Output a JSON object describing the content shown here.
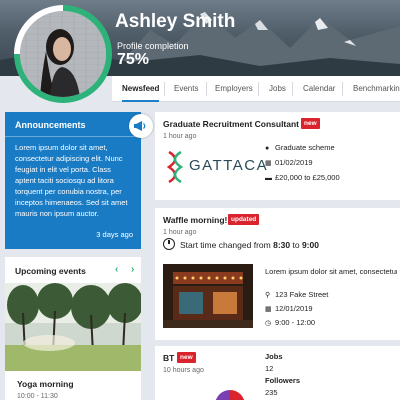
{
  "profile": {
    "name": "Ashley Smith",
    "completion_label": "Profile completion",
    "completion_value": "75%",
    "completion_fraction": 0.75
  },
  "tabs": [
    {
      "label": "Newsfeed",
      "active": true
    },
    {
      "label": "Events"
    },
    {
      "label": "Employers"
    },
    {
      "label": "Jobs"
    },
    {
      "label": "Calendar"
    },
    {
      "label": "Benchmarking"
    }
  ],
  "announcements": {
    "title": "Announcements",
    "body": "Lorem ipsum dolor sit amet, consectetur adipiscing elit. Nunc feugiat in elit vel porta. Class aptent taciti sociosqu ad litora torquent per conubia nostra, per inceptos himenaeos. Sed sit amet mauris non ipsum auctor.",
    "date": "3 days ago",
    "icon": "megaphone-icon"
  },
  "events": {
    "title": "Upcoming events",
    "prev_icon": "‹",
    "next_icon": "›",
    "event_name": "Yoga morning",
    "event_time": "10:00 - 11:30"
  },
  "feed": [
    {
      "title": "Graduate Recruitment Consultant",
      "badge": "new",
      "time": "1 hour ago",
      "logo_text": "GATTACA",
      "details": [
        "Graduate scheme",
        "01/02/2019",
        "£20,000 to £25,000"
      ]
    },
    {
      "title": "Waffle morning!",
      "badge": "updated",
      "time": "1 hour ago",
      "start_prefix": "Start time changed from",
      "start_from": "8:30",
      "start_to": "9:00",
      "desc": "Lorem ipsum dolor sit amet, consectetur adipiscing elit.",
      "address": "123 Fake Street",
      "date": "12/01/2019",
      "time_range": "9:00 - 12:00"
    },
    {
      "title": "BT",
      "badge": "new",
      "time": "10 hours ago",
      "jobs_label": "Jobs",
      "jobs_value": "12",
      "followers_label": "Followers",
      "followers_value": "235"
    }
  ],
  "colors": {
    "accent_blue": "#1a7bc5",
    "accent_green": "#2db37a",
    "badge_red": "#d9232d"
  }
}
